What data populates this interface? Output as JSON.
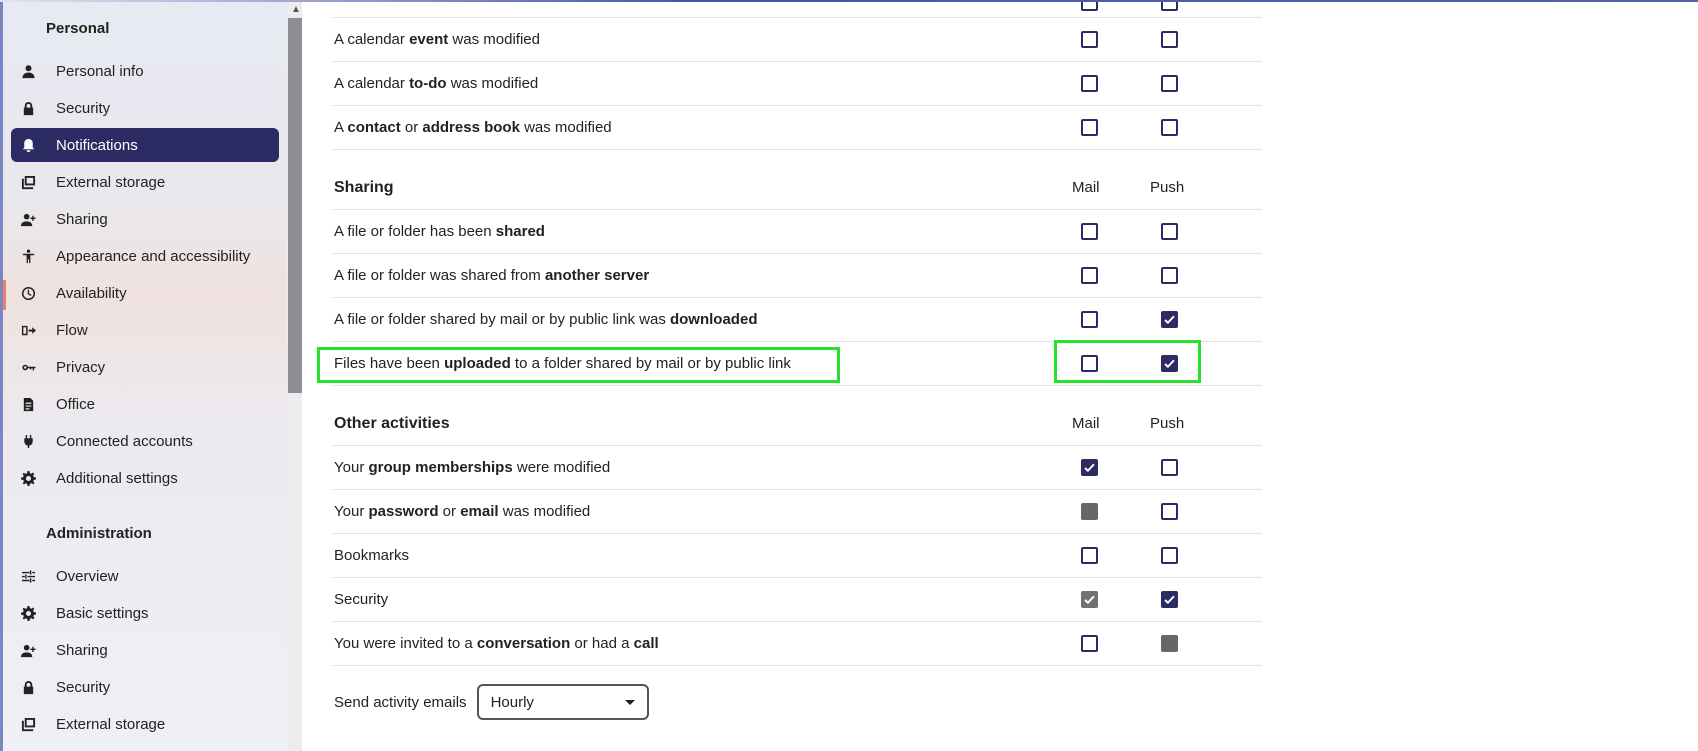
{
  "sidebar": {
    "personal_title": "Personal",
    "personal_items": [
      {
        "label": "Personal info",
        "icon": "person-icon"
      },
      {
        "label": "Security",
        "icon": "lock-icon"
      },
      {
        "label": "Notifications",
        "icon": "bell-icon",
        "active": true
      },
      {
        "label": "External storage",
        "icon": "external-storage-icon"
      },
      {
        "label": "Sharing",
        "icon": "share-person-icon"
      },
      {
        "label": "Appearance and accessibility",
        "icon": "accessibility-icon"
      },
      {
        "label": "Availability",
        "icon": "clock-icon"
      },
      {
        "label": "Flow",
        "icon": "flow-icon"
      },
      {
        "label": "Privacy",
        "icon": "key-icon"
      },
      {
        "label": "Office",
        "icon": "document-icon"
      },
      {
        "label": "Connected accounts",
        "icon": "plug-icon"
      },
      {
        "label": "Additional settings",
        "icon": "gear-icon"
      }
    ],
    "admin_title": "Administration",
    "admin_items": [
      {
        "label": "Overview",
        "icon": "sliders-icon"
      },
      {
        "label": "Basic settings",
        "icon": "gear-icon"
      },
      {
        "label": "Sharing",
        "icon": "share-person-icon"
      },
      {
        "label": "Security",
        "icon": "lock-icon"
      },
      {
        "label": "External storage",
        "icon": "external-storage-icon"
      }
    ]
  },
  "columns": {
    "mail": "Mail",
    "push": "Push"
  },
  "calendar_rows": [
    {
      "parts": [
        "A calendar ",
        "event",
        " was modified"
      ],
      "mail": "unchecked",
      "push": "unchecked"
    },
    {
      "parts": [
        "A calendar ",
        "to-do",
        " was modified"
      ],
      "mail": "unchecked",
      "push": "unchecked"
    },
    {
      "parts": [
        "A ",
        "contact",
        " or ",
        "address book",
        " was modified"
      ],
      "mail": "unchecked",
      "push": "unchecked"
    }
  ],
  "sharing": {
    "title": "Sharing",
    "rows": [
      {
        "parts": [
          "A file or folder has been ",
          "shared"
        ],
        "mail": "unchecked",
        "push": "unchecked"
      },
      {
        "parts": [
          "A file or folder was shared from ",
          "another server"
        ],
        "mail": "unchecked",
        "push": "unchecked"
      },
      {
        "parts": [
          "A file or folder shared by mail or by public link was ",
          "downloaded"
        ],
        "mail": "unchecked",
        "push": "checked"
      },
      {
        "parts": [
          "Files have been ",
          "uploaded",
          " to a folder shared by mail or by public link"
        ],
        "mail": "unchecked",
        "push": "checked"
      }
    ]
  },
  "other": {
    "title": "Other activities",
    "rows": [
      {
        "parts": [
          "Your ",
          "group memberships",
          " were modified"
        ],
        "mail": "checked",
        "push": "unchecked"
      },
      {
        "parts": [
          "Your ",
          "password",
          " or ",
          "email",
          " was modified"
        ],
        "mail": "filled-grey",
        "push": "unchecked"
      },
      {
        "parts": [
          "Bookmarks"
        ],
        "mail": "unchecked",
        "push": "unchecked"
      },
      {
        "parts": [
          "Security"
        ],
        "mail": "checked-grey",
        "push": "checked"
      },
      {
        "parts": [
          "You were invited to a ",
          "conversation",
          " or had a ",
          "call"
        ],
        "mail": "unchecked",
        "push": "filled-grey"
      }
    ]
  },
  "activity_emails": {
    "label": "Send activity emails",
    "selected": "Hourly"
  },
  "colors": {
    "accent": "#2c2b64",
    "highlight": "#28e12a"
  }
}
